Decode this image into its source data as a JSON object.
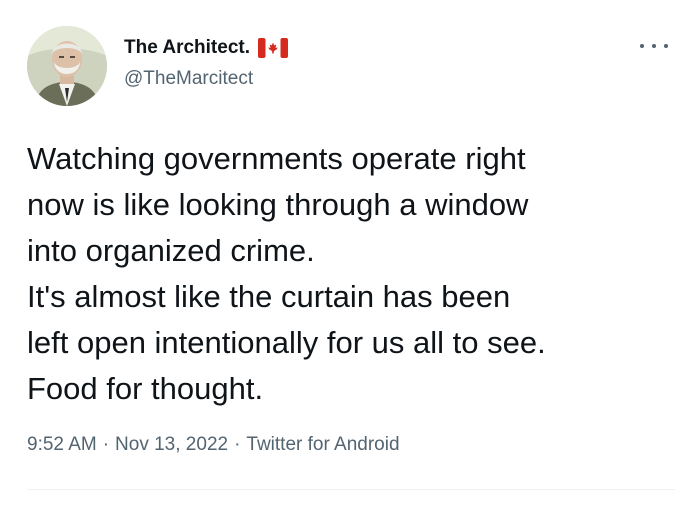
{
  "author": {
    "display_name": "The Architect.",
    "handle": "@TheMarcitect",
    "flag_icon": "canada-flag-icon",
    "avatar_icon": "avatar-portrait"
  },
  "menu": {
    "more_icon": "more-horizontal-icon"
  },
  "tweet": {
    "lines": [
      "Watching governments operate right",
      "now is like looking through a window",
      "into organized crime.",
      "It's almost like the curtain has been",
      "left open intentionally for us all to see.",
      "Food for thought."
    ]
  },
  "meta": {
    "time": "9:52 AM",
    "separator": "·",
    "date": "Nov 13, 2022",
    "source": "Twitter for Android"
  },
  "colors": {
    "text": "#0f1419",
    "secondary": "#536471",
    "flag_red": "#d52b1e",
    "divider": "#eff3f4"
  }
}
